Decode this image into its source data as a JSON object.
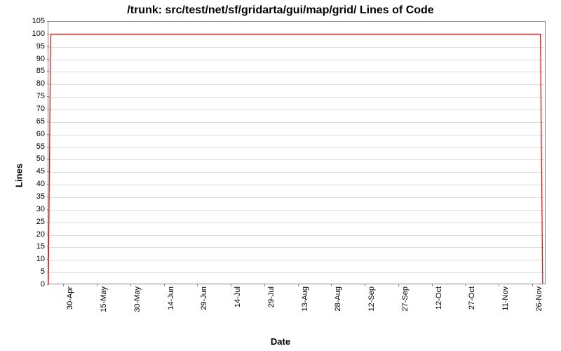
{
  "chart_data": {
    "type": "line",
    "title": "/trunk: src/test/net/sf/gridarta/gui/map/grid/ Lines of Code",
    "xlabel": "Date",
    "ylabel": "Lines",
    "ylim": [
      0,
      105
    ],
    "y_ticks": [
      0,
      5,
      10,
      15,
      20,
      25,
      30,
      35,
      40,
      45,
      50,
      55,
      60,
      65,
      70,
      75,
      80,
      85,
      90,
      95,
      100,
      105
    ],
    "x_ticks": [
      "30-Apr",
      "15-May",
      "30-May",
      "14-Jun",
      "29-Jun",
      "14-Jul",
      "29-Jul",
      "13-Aug",
      "28-Aug",
      "12-Sep",
      "27-Sep",
      "12-Oct",
      "27-Oct",
      "11-Nov",
      "26-Nov"
    ],
    "series": [
      {
        "name": "Lines of Code",
        "color": "#ff0000",
        "x": [
          "23-Apr",
          "24-Apr",
          "30-Nov",
          "01-Dec"
        ],
        "y": [
          0,
          100,
          100,
          0
        ]
      }
    ],
    "x_range_days": 223,
    "x_tick_offsets_days": [
      7,
      22,
      37,
      52,
      67,
      82,
      97,
      112,
      127,
      142,
      157,
      172,
      187,
      202,
      217
    ],
    "series_offsets_days": [
      0,
      1,
      221,
      222
    ]
  }
}
